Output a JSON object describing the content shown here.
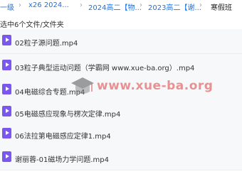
{
  "breadcrumb": {
    "items": [
      "一级",
      "x26 2024...",
      "2024高二【物...",
      "2023高二【谢...",
      "寒假班"
    ],
    "separator": "›"
  },
  "selection_info": "选中6个文件/文件夹",
  "files": [
    {
      "name": "02粒子源问题.mp4",
      "type_icon": "video-file-icon"
    },
    {
      "name": "03粒子典型运动问题（学霸网 www.xue-ba.org）.mp4",
      "type_icon": "video-file-icon"
    },
    {
      "name": "04电磁综合专题.mp4",
      "type_icon": "video-file-icon"
    },
    {
      "name": "05电磁感应现象与楞次定律.mp4",
      "type_icon": "video-file-icon"
    },
    {
      "name": "06法拉第电磁感应定律1.mp4",
      "type_icon": "video-file-icon"
    },
    {
      "name": "谢丽蓉-01磁场力学问题.mp4",
      "type_icon": "video-file-icon"
    }
  ],
  "watermark": {
    "text": "www.xue-ba.org"
  },
  "colors": {
    "accent": "#1a73e8",
    "video_icon": "#7b57f0",
    "row_bg": "#f7f8fa"
  }
}
